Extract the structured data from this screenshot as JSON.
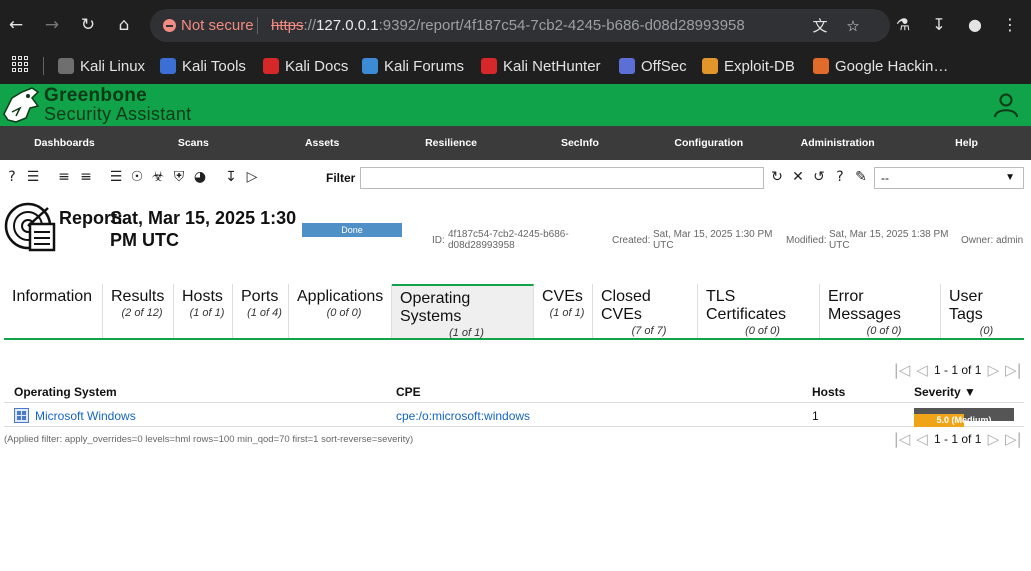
{
  "browser": {
    "security_text": "Not secure",
    "url_scheme": "https",
    "url_host": "127.0.0.1",
    "url_rest": ":9392/report/4f187c54-7cb2-4245-b686-d08d28993958",
    "bookmarks": [
      {
        "label": "Kali Linux",
        "color": "#6f6f6f"
      },
      {
        "label": "Kali Tools",
        "color": "#3b6fd6"
      },
      {
        "label": "Kali Docs",
        "color": "#d62828"
      },
      {
        "label": "Kali Forums",
        "color": "#3b8bd6"
      },
      {
        "label": "Kali NetHunter",
        "color": "#d62828"
      },
      {
        "label": "OffSec",
        "color": "#5b6fd6"
      },
      {
        "label": "Exploit-DB",
        "color": "#e0962a"
      },
      {
        "label": "Google Hackin…",
        "color": "#e06b2a"
      }
    ]
  },
  "app": {
    "brand_line1": "Greenbone",
    "brand_line2": "Security Assistant",
    "brand_color": "#11a34a",
    "menu": [
      "Dashboards",
      "Scans",
      "Assets",
      "Resilience",
      "SecInfo",
      "Configuration",
      "Administration",
      "Help"
    ]
  },
  "toolbar": {
    "filter_label": "Filter",
    "filter_value": "",
    "filter_select": "--"
  },
  "report": {
    "title": "Report:",
    "date": "Sat, Mar 15, 2025 1:30 PM UTC",
    "status": "Done",
    "id_label": "ID:",
    "id_value": "4f187c54-7cb2-4245-b686-d08d28993958",
    "created_label": "Created:",
    "created_value": "Sat, Mar 15, 2025 1:30 PM UTC",
    "modified_label": "Modified:",
    "modified_value": "Sat, Mar 15, 2025 1:38 PM UTC",
    "owner_label": "Owner:",
    "owner_value": "admin"
  },
  "tabs": [
    {
      "label": "Information",
      "count": ""
    },
    {
      "label": "Results",
      "count": "(2 of 12)"
    },
    {
      "label": "Hosts",
      "count": "(1 of 1)"
    },
    {
      "label": "Ports",
      "count": "(1 of 4)"
    },
    {
      "label": "Applications",
      "count": "(0 of 0)"
    },
    {
      "label": "Operating Systems",
      "count": "(1 of 1)"
    },
    {
      "label": "CVEs",
      "count": "(1 of 1)"
    },
    {
      "label": "Closed CVEs",
      "count": "(7 of 7)"
    },
    {
      "label": "TLS Certificates",
      "count": "(0 of 0)"
    },
    {
      "label": "Error Messages",
      "count": "(0 of 0)"
    },
    {
      "label": "User Tags",
      "count": "(0)"
    }
  ],
  "pagination": {
    "text": "1 - 1 of 1"
  },
  "table": {
    "columns": [
      "Operating System",
      "CPE",
      "Hosts",
      "Severity ▼"
    ],
    "rows": [
      {
        "os": "Microsoft Windows",
        "cpe": "cpe:/o:microsoft:windows",
        "hosts": "1",
        "severity": "5.0 (Medium)",
        "severity_fraction": 0.5,
        "severity_color": "#f0a519"
      }
    ]
  },
  "applied_filter": "(Applied filter: apply_overrides=0 levels=hml rows=100 min_qod=70 first=1 sort-reverse=severity)"
}
